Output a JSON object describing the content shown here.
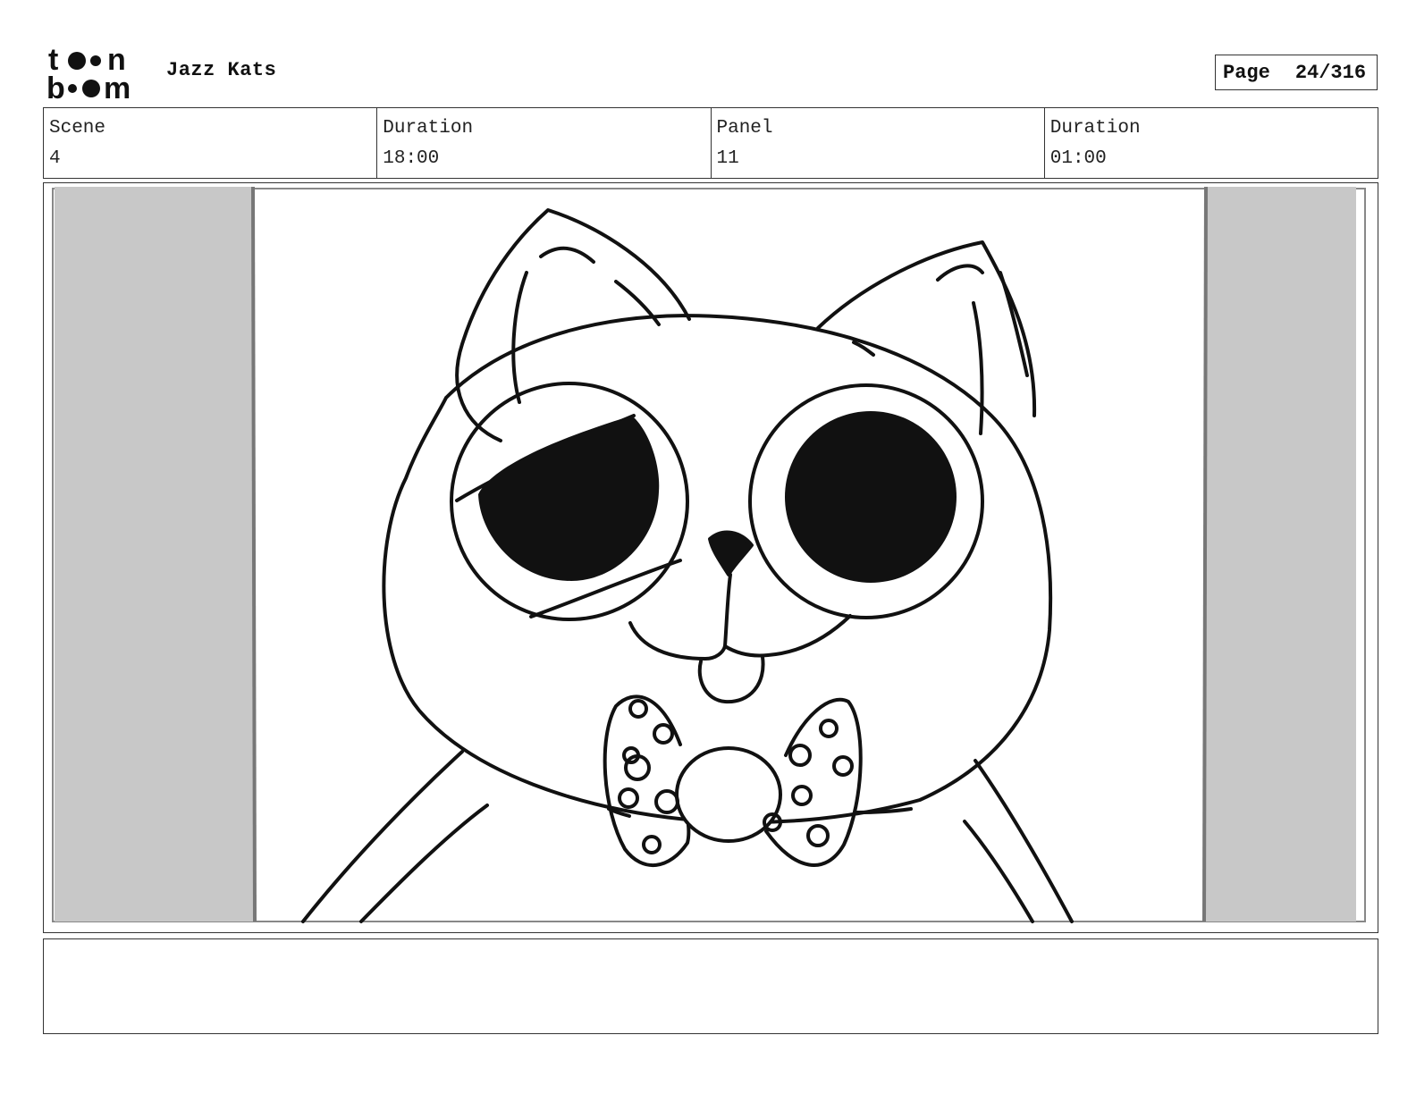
{
  "header": {
    "logo_top": "t●●n",
    "logo_bottom": "b●●m",
    "project_title": "Jazz Kats",
    "page_label": "Page",
    "page_number": "24/316"
  },
  "info": [
    {
      "label": "Scene",
      "value": "4"
    },
    {
      "label": "Duration",
      "value": "18:00"
    },
    {
      "label": "Panel",
      "value": "11"
    },
    {
      "label": "Duration",
      "value": "01:00"
    }
  ],
  "panel": {
    "illustration": "cat-face-with-bowtie",
    "side_bar_color": "#c8c8c8"
  },
  "notes": {
    "text": ""
  }
}
